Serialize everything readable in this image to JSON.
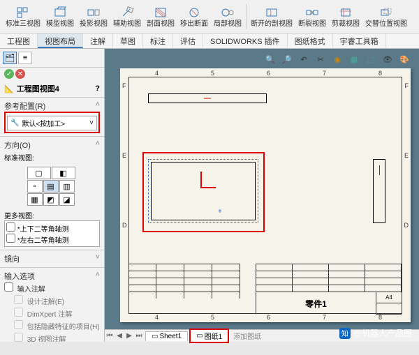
{
  "ribbon": {
    "items": [
      {
        "label": "标准三视图",
        "icon": "std-views"
      },
      {
        "label": "模型视图",
        "icon": "model-view"
      },
      {
        "label": "投影视图",
        "icon": "projected-view"
      },
      {
        "label": "辅助视图",
        "icon": "aux-view"
      },
      {
        "label": "剖面视图",
        "icon": "section-view"
      },
      {
        "label": "移出断面",
        "icon": "removed-section"
      },
      {
        "label": "局部视图",
        "icon": "detail-view"
      },
      {
        "label": "断开的剖视图",
        "icon": "broken-section"
      },
      {
        "label": "断裂视图",
        "icon": "break-view"
      },
      {
        "label": "剪裁视图",
        "icon": "crop-view"
      },
      {
        "label": "交替位置视图",
        "icon": "alt-position"
      }
    ]
  },
  "tabs": [
    "工程图",
    "视图布局",
    "注解",
    "草图",
    "标注",
    "评估",
    "SOLIDWORKS 插件",
    "图纸格式",
    "宇睿工具箱"
  ],
  "active_tab": "视图布局",
  "panel": {
    "title": "工程图视图4",
    "confirm_icons": [
      "✓",
      "✕"
    ],
    "ref_config": {
      "title": "参考配置(R)",
      "value": "默认<按加工>"
    },
    "orientation": {
      "title": "方向(O)",
      "std_label": "标准视图:",
      "more_label": "更多视图:",
      "options": [
        "*上下二等角轴测",
        "*左右二等角轴测"
      ]
    },
    "mirror": "镜向",
    "import": {
      "title": "输入选项",
      "main": "输入注解",
      "items": [
        "设计注解(E)",
        "DimXpert 注解",
        "包括隐藏特征的项目(H)",
        "3D 视图注解"
      ]
    }
  },
  "sheet": {
    "ruler_top": [
      "4",
      "5",
      "6",
      "7",
      "8"
    ],
    "ruler_bottom": [
      "4",
      "5",
      "6",
      "7",
      "8"
    ],
    "side_letters": [
      "F",
      "E",
      "D"
    ],
    "titleblock": {
      "part": "零件1",
      "format": "A4"
    }
  },
  "bottom_tabs": {
    "sheets": [
      "Sheet1",
      "图纸1"
    ],
    "add": "添加图纸"
  },
  "watermark": "@机器人产品圈"
}
